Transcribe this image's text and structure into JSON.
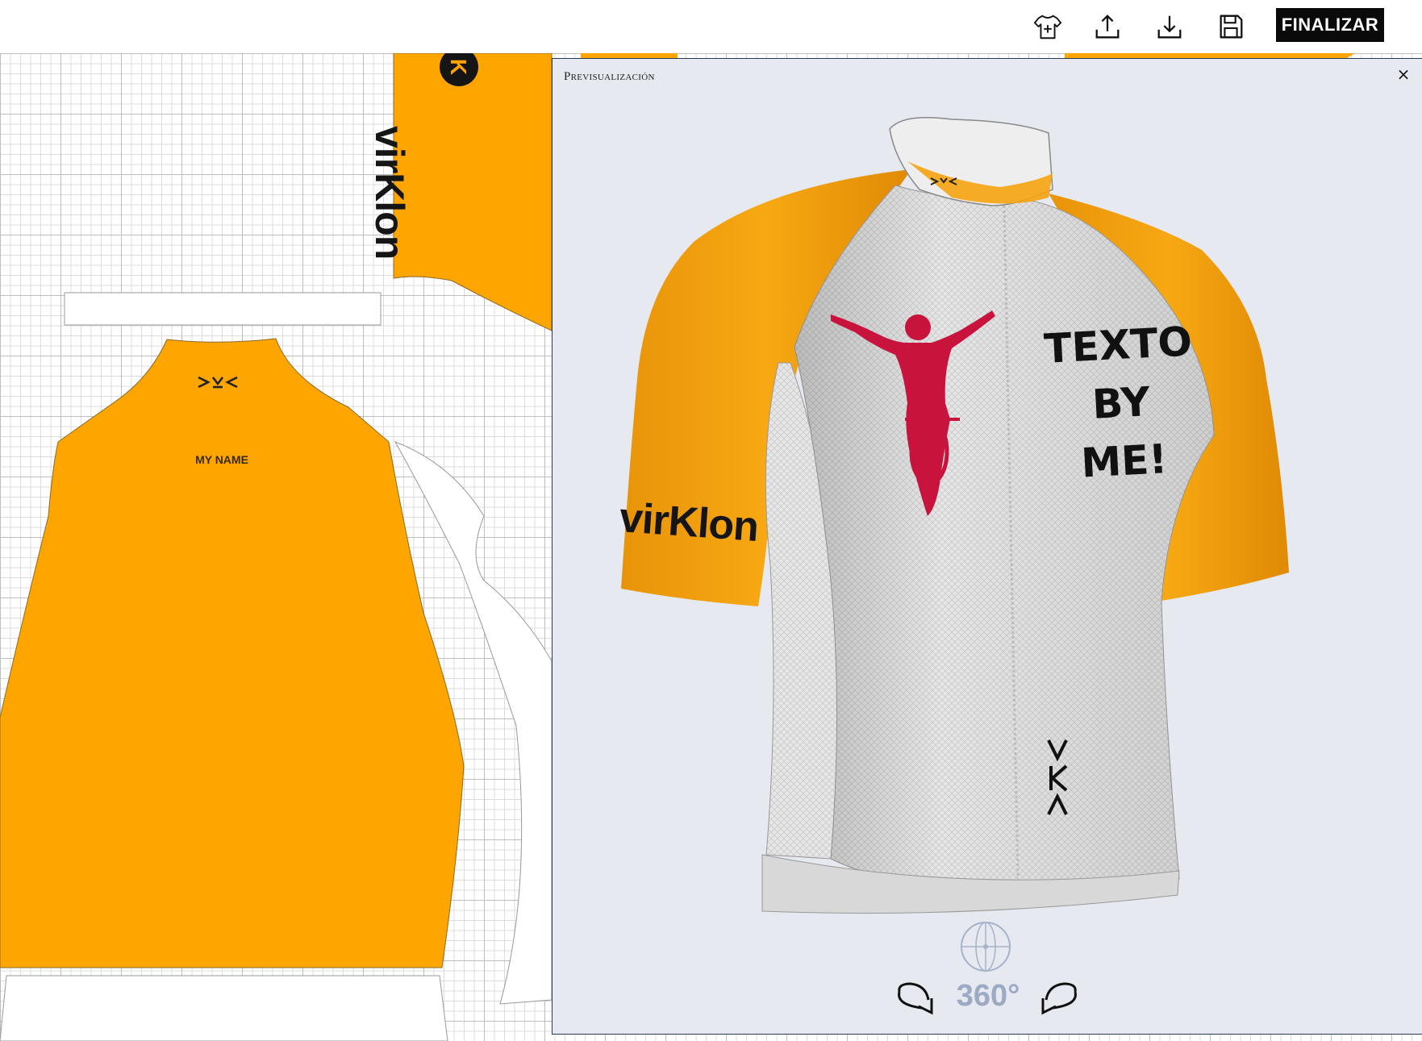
{
  "toolbar": {
    "icons": [
      "add-shirt-icon",
      "upload-icon",
      "download-icon",
      "save-icon"
    ],
    "finalize_label": "FINALIZAR"
  },
  "canvas": {
    "brand_sleeve": "virKlon",
    "neck_label": "MY NAME",
    "panel_color": "#FFA500"
  },
  "preview": {
    "title": "Previsualización",
    "close_symbol": "×",
    "jersey_text": "TEXTO BY ME!",
    "sleeve_brand": "virKlon",
    "rotate_label": "360°",
    "colors": {
      "sleeve": "#F5A310",
      "body": "#e8e8e8",
      "rider": "#c8143c"
    }
  }
}
